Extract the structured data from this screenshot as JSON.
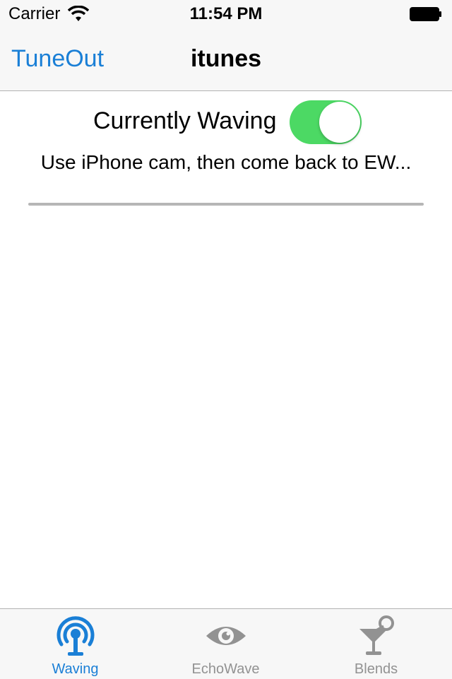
{
  "status_bar": {
    "carrier": "Carrier",
    "time": "11:54 PM"
  },
  "nav": {
    "back_label": "TuneOut",
    "title": "itunes"
  },
  "content": {
    "waving_label": "Currently Waving",
    "waving_on": true,
    "hint": "Use iPhone cam, then come back to EW...",
    "progress": 0
  },
  "tabs": [
    {
      "label": "Waving",
      "icon": "antenna-icon",
      "active": true
    },
    {
      "label": "EchoWave",
      "icon": "eye-icon",
      "active": false
    },
    {
      "label": "Blends",
      "icon": "cocktail-icon",
      "active": false
    }
  ],
  "colors": {
    "accent": "#1a7fd6",
    "toggle_on": "#4cd964",
    "inactive": "#929292",
    "bar_bg": "#f7f7f7"
  }
}
